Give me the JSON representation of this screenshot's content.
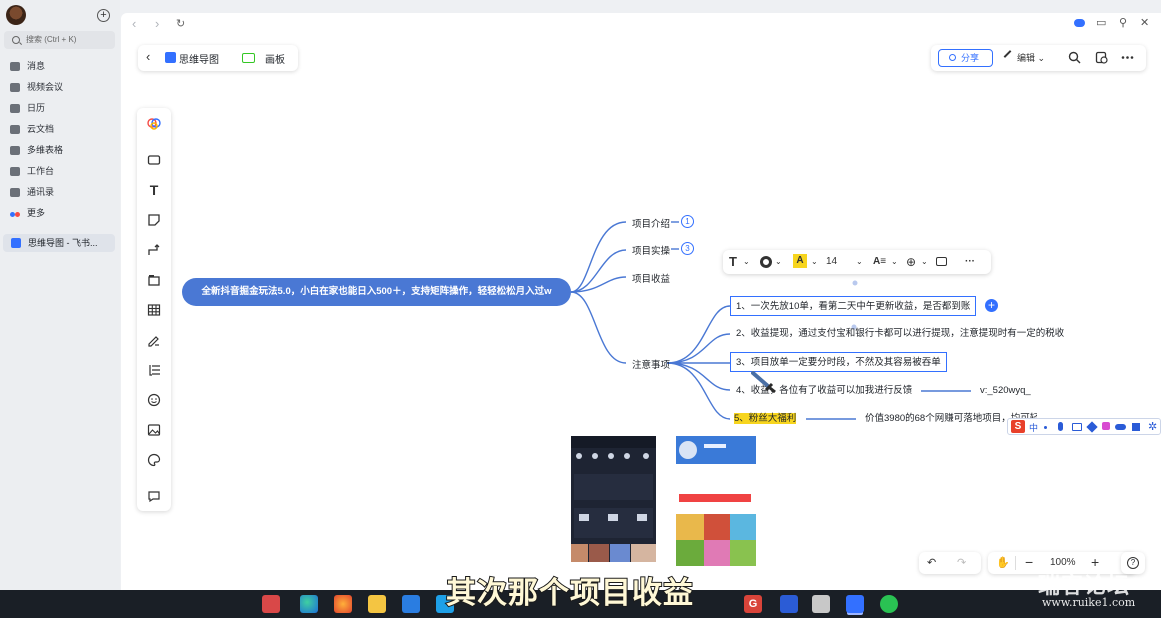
{
  "sidebar": {
    "search_placeholder": "搜索 (Ctrl + K)",
    "items": [
      {
        "label": "消息"
      },
      {
        "label": "视频会议"
      },
      {
        "label": "日历"
      },
      {
        "label": "云文档"
      },
      {
        "label": "多维表格"
      },
      {
        "label": "工作台"
      },
      {
        "label": "通讯录"
      },
      {
        "label": "更多"
      }
    ],
    "open_doc": "思维导图 - 飞书..."
  },
  "header": {
    "mindmap_label": "思维导图",
    "board_label": "画板",
    "share_label": "分享",
    "edit_label": "编辑"
  },
  "mindmap": {
    "root": "全新抖音掘金玩法5.0，小白在家也能日入500＋，支持矩阵操作，轻轻松松月入过w",
    "branches": [
      {
        "label": "项目介绍",
        "badge": "1"
      },
      {
        "label": "项目实操",
        "badge": "3"
      },
      {
        "label": "项目收益"
      },
      {
        "label": "注意事项"
      }
    ],
    "notes": [
      "1、一次先放10单，看第二天中午更新收益，是否都到账",
      "2、收益提现，通过支付宝和银行卡都可以进行提现，注意提现时有一定的税收",
      "3、项目放单一定要分时段，不然及其容易被吞单",
      "4、收益，各位有了收益可以加我进行反馈",
      "5、粉丝大福利"
    ],
    "note4_extra": "v:_520wyq_",
    "note5_extra": "价值3980的68个网赚可落地项目，均可轻松过服务"
  },
  "format_bar": {
    "font_size": "14"
  },
  "zoom": {
    "level": "100%"
  },
  "overlay": {
    "subtitle": "其次那个项目收益",
    "watermark": "瑞客论坛",
    "watermark_url": "www.ruike1.com"
  },
  "colors": {
    "accent": "#3370ff",
    "root_node": "#4a78d4",
    "highlight": "#f7d51e",
    "connector": "#4a78d4"
  }
}
